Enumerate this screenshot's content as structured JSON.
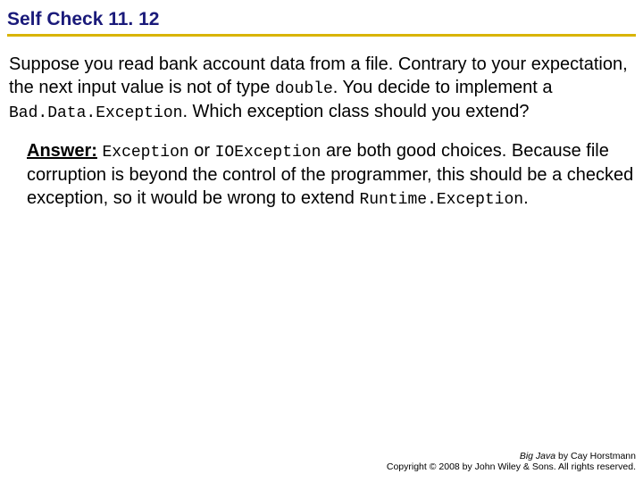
{
  "title": "Self Check 11. 12",
  "question": {
    "p1": "Suppose you read bank account data from a file. Contrary to your expectation, the next input value is not of type ",
    "code1": "double",
    "p2": ". You decide to implement a ",
    "code2": "Bad.Data.Exception",
    "p3": ". Which exception class should you extend?"
  },
  "answer": {
    "label": "Answer:",
    "code1": "Exception",
    "mid1": " or ",
    "code2": "IOException",
    "p1": " are both good choices. Because file corruption is beyond the control of the programmer, this should be a checked exception, so it would be wrong to extend ",
    "code3": "Runtime.Exception",
    "p2": "."
  },
  "footer": {
    "book": "Big Java",
    "author": " by Cay Horstmann",
    "copyright": "Copyright © 2008 by John Wiley & Sons. All rights reserved."
  }
}
